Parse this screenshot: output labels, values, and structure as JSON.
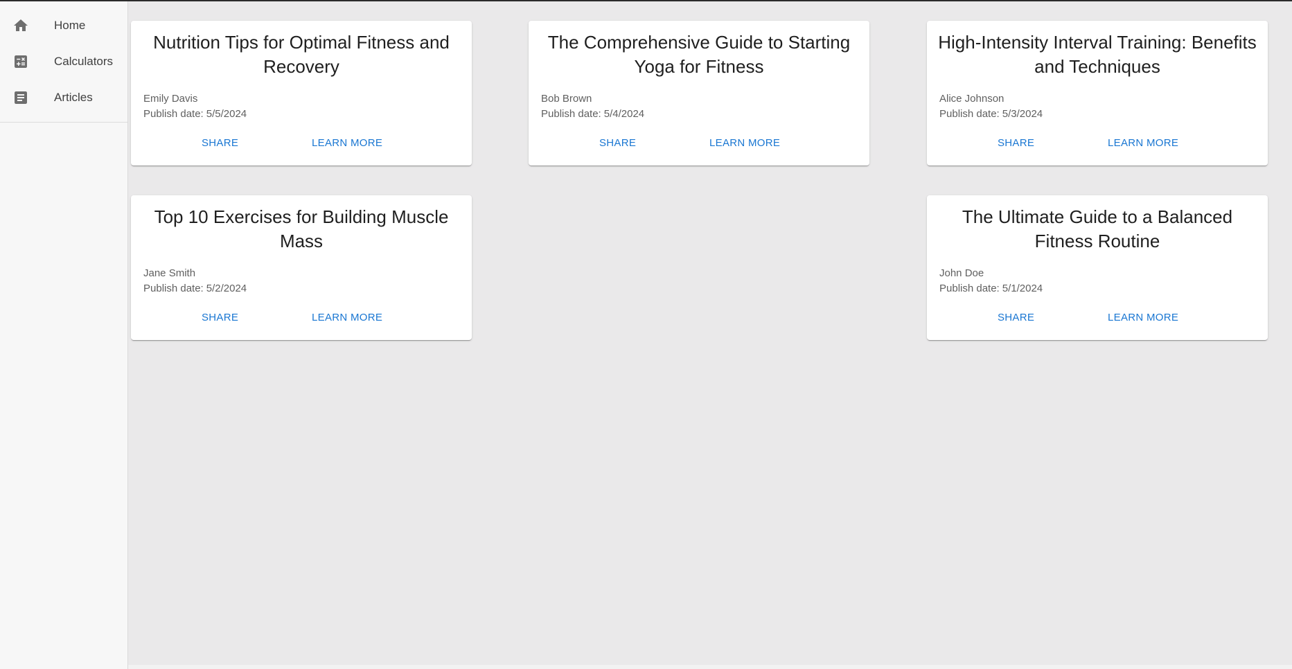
{
  "sidebar": {
    "items": [
      {
        "label": "Home",
        "icon": "home-icon"
      },
      {
        "label": "Calculators",
        "icon": "calculator-icon"
      },
      {
        "label": "Articles",
        "icon": "article-icon"
      }
    ]
  },
  "card_labels": {
    "publish_prefix": "Publish date:",
    "share": "SHARE",
    "learn_more": "LEARN MORE"
  },
  "articles": [
    {
      "title": "Nutrition Tips for Optimal Fitness and Recovery",
      "author": "Emily Davis",
      "date": "5/5/2024"
    },
    {
      "title": "The Comprehensive Guide to Starting Yoga for Fitness",
      "author": "Bob Brown",
      "date": "5/4/2024"
    },
    {
      "title": "High-Intensity Interval Training: Benefits and Techniques",
      "author": "Alice Johnson",
      "date": "5/3/2024"
    },
    {
      "title": "Top 10 Exercises for Building Muscle Mass",
      "author": "Jane Smith",
      "date": "5/2/2024"
    },
    {
      "title": "The Ultimate Guide to a Balanced Fitness Routine",
      "author": "John Doe",
      "date": "5/1/2024"
    }
  ],
  "colors": {
    "accent": "#1976d2",
    "background": "#eae9ea",
    "sidebar": "#f7f7f7"
  }
}
